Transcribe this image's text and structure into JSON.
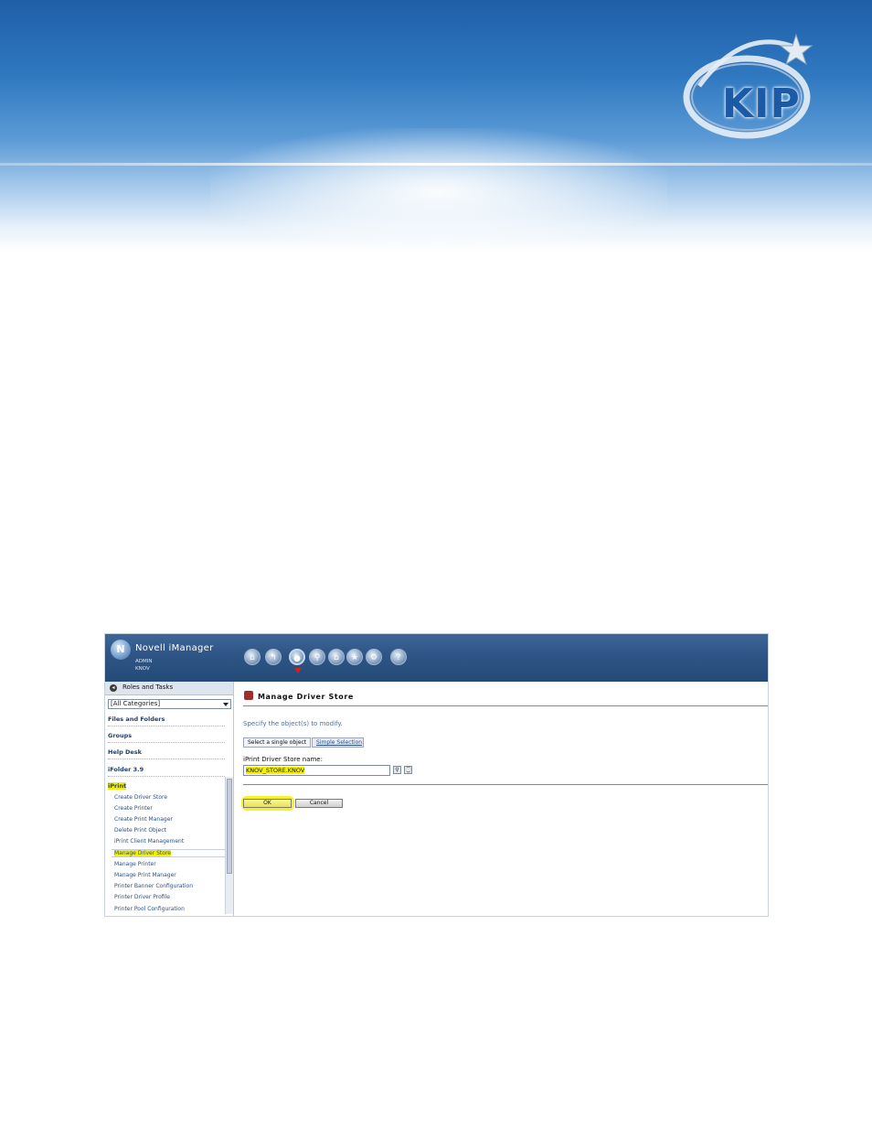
{
  "banner": {
    "logo_text": "KIP"
  },
  "app": {
    "logo_letter": "N",
    "title": "Novell iManager",
    "user_line1": "ADMIN",
    "user_line2": "KNOV",
    "toolbar_icons": [
      "home-icon",
      "back-icon",
      "roles-icon",
      "view-icon",
      "favorites-icon",
      "star-icon",
      "configure-icon",
      "help-icon"
    ],
    "toolbar_glyphs": [
      "⌂",
      "↰",
      "●",
      "⚲",
      "⌂",
      "★",
      "⚙",
      "?"
    ]
  },
  "sidebar": {
    "header": "Roles and Tasks",
    "category_select": "[All Categories]",
    "categories": [
      "Files and Folders",
      "Groups",
      "Help Desk",
      "iFolder 3.9",
      "iPrint"
    ],
    "tasks": [
      "Create Driver Store",
      "Create Printer",
      "Create Print Manager",
      "Delete Print Object",
      "iPrint Client Management",
      "Manage Driver Store",
      "Manage Printer",
      "Manage Print Manager",
      "Printer Banner Configuration",
      "Printer Driver Profile",
      "Printer Pool Configuration"
    ]
  },
  "main": {
    "title": "Manage Driver Store",
    "instruction": "Specify the object(s) to modify.",
    "tab_single": "Select a single object",
    "tab_simple": "Simple Selection",
    "field_label": "iPrint Driver Store name:",
    "field_value": "KNOV_STORE.KNOV",
    "ok_label": "OK",
    "cancel_label": "Cancel"
  },
  "colors": {
    "banner_blue": "#1f5fa8",
    "header_blue": "#2f5686",
    "highlight": "#f4f000",
    "link_blue": "#2a4f8a"
  }
}
